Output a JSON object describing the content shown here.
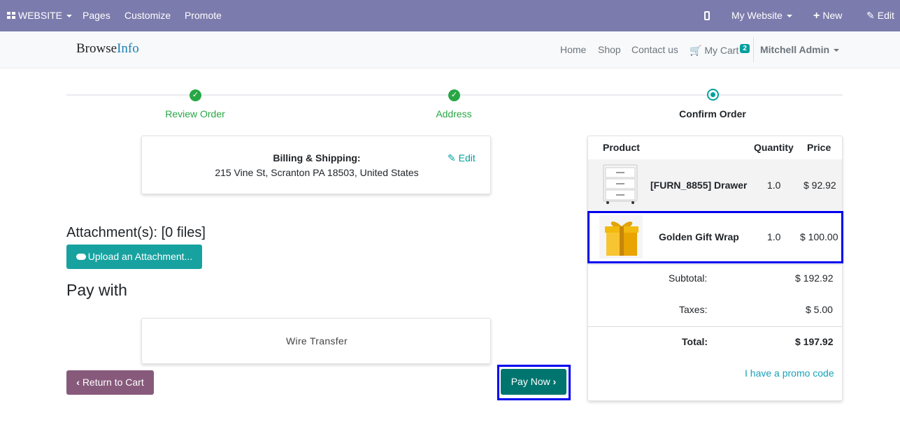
{
  "admin_bar": {
    "website_label": "WEBSITE",
    "pages_label": "Pages",
    "customize_label": "Customize",
    "promote_label": "Promote",
    "my_website_label": "My Website",
    "new_label": "New",
    "edit_label": "Edit"
  },
  "navbar": {
    "brand_part1": "Browse",
    "brand_part2": "Info",
    "links": [
      "Home",
      "Shop",
      "Contact us"
    ],
    "cart_label": "My Cart",
    "cart_count": "2",
    "user_name": "Mitchell Admin"
  },
  "wizard": {
    "steps": [
      {
        "label": "Review Order",
        "status": "done"
      },
      {
        "label": "Address",
        "status": "done"
      },
      {
        "label": "Confirm Order",
        "status": "current"
      }
    ]
  },
  "billing": {
    "title": "Billing & Shipping:",
    "address": "215 Vine St, Scranton PA 18503, United States",
    "edit_label": "Edit"
  },
  "attachments": {
    "title": "Attachment(s): [0 files]",
    "upload_label": "Upload an Attachment..."
  },
  "payment": {
    "title": "Pay with",
    "method": "Wire Transfer"
  },
  "buttons": {
    "return_label": "Return to Cart",
    "pay_now_label": "Pay Now"
  },
  "summary": {
    "headers": {
      "product": "Product",
      "quantity": "Quantity",
      "price": "Price"
    },
    "lines": [
      {
        "name": "[FURN_8855] Drawer",
        "quantity": "1.0",
        "price": "$ 92.92"
      },
      {
        "name": "Golden Gift Wrap",
        "quantity": "1.0",
        "price": "$ 100.00"
      }
    ],
    "subtotal_label": "Subtotal:",
    "subtotal_value": "$ 192.92",
    "taxes_label": "Taxes:",
    "taxes_value": "$ 5.00",
    "total_label": "Total:",
    "total_value": "$ 197.92",
    "promo_label": "I have a promo code"
  },
  "colors": {
    "admin_bar": "#7c7bad",
    "accent": "#00a09d",
    "success": "#28a745",
    "return_button": "#875a7b",
    "pay_button": "#00756f",
    "highlight_frame": "#0000ee"
  }
}
